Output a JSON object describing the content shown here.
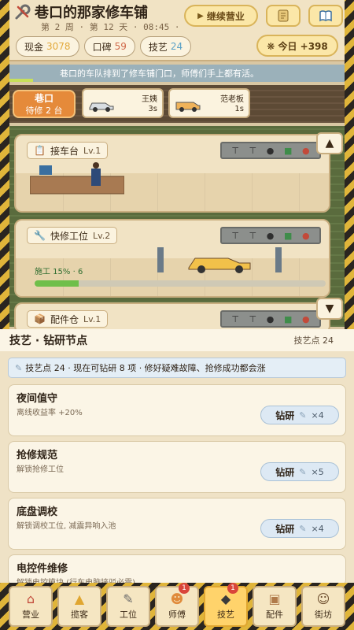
{
  "header": {
    "title": "巷口的那家修车铺",
    "subline": "第 2 周 · 第 12 天 · 08:45 · 已营",
    "continue_label": "继续营业",
    "stats": [
      {
        "label": "现金",
        "value": "3078"
      },
      {
        "label": "口碑",
        "value": "59"
      },
      {
        "label": "技艺",
        "value": "24"
      }
    ],
    "today": "❋ 今日 +398"
  },
  "notice": "巷口的车队排到了修车铺门口，师傅们手上都有活。",
  "queue": {
    "label_line1": "巷口",
    "label_line2": "待修 2 台",
    "cars": [
      {
        "name": "王姨",
        "time": "3s"
      },
      {
        "name": "范老板",
        "time": "1s"
      }
    ]
  },
  "stations": [
    {
      "name": "接车台",
      "level": "Lv.1"
    },
    {
      "name": "快修工位",
      "level": "Lv.2",
      "progress_text": "施工 15% · 6",
      "progress": 0.15
    },
    {
      "name": "配件仓",
      "level": "Lv.1"
    }
  ],
  "panel": {
    "title": "技艺 · 钻研节点",
    "points_label": "技艺点 24",
    "info": "技艺点 24 · 现在可钻研 8 项 · 修好疑难故障、抢修成功都会涨",
    "research_label": "钻研",
    "nodes": [
      {
        "name": "夜间值守",
        "desc": "离线收益率 +20%",
        "cost": "×4"
      },
      {
        "name": "抢修规范",
        "desc": "解锁抢修工位",
        "cost": "×5"
      },
      {
        "name": "底盘调校",
        "desc": "解锁调校工位, 减震异响入池",
        "cost": "×4"
      },
      {
        "name": "电控件维修",
        "desc": "解锁电控模块 (行车电脑接驳必需)",
        "cost": ""
      }
    ]
  },
  "nav": [
    {
      "label": "营业",
      "icon": "home-icon",
      "glyph": "⌂"
    },
    {
      "label": "揽客",
      "icon": "megaphone-icon",
      "glyph": "▲"
    },
    {
      "label": "工位",
      "icon": "wrench-icon",
      "glyph": "✎"
    },
    {
      "label": "师傅",
      "icon": "worker-icon",
      "glyph": "☻",
      "badge": "1"
    },
    {
      "label": "技艺",
      "icon": "graduation-icon",
      "glyph": "◆",
      "badge": "1"
    },
    {
      "label": "配件",
      "icon": "box-icon",
      "glyph": "▣"
    },
    {
      "label": "街坊",
      "icon": "people-icon",
      "glyph": "☺"
    }
  ]
}
